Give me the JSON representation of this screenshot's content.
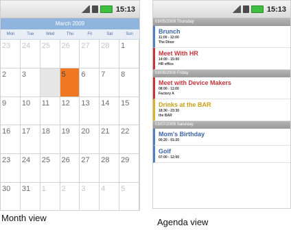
{
  "status": {
    "time": "15:13"
  },
  "month": {
    "title": "March 2009",
    "weekdays": [
      "Mon",
      "Tue",
      "Wed",
      "Thu",
      "Fri",
      "Sat",
      "Sun"
    ],
    "weeks": [
      [
        "23",
        "24",
        "25",
        "26",
        "27",
        "28",
        "1"
      ],
      [
        "2",
        "3",
        "",
        "5",
        "6",
        "7",
        "8"
      ],
      [
        "9",
        "10",
        "11",
        "12",
        "13",
        "14",
        "15"
      ],
      [
        "16",
        "17",
        "18",
        "19",
        "20",
        "21",
        "22"
      ],
      [
        "23",
        "24",
        "25",
        "26",
        "27",
        "28",
        "29"
      ],
      [
        "30",
        "31",
        "1",
        "2",
        "3",
        "4",
        "5"
      ]
    ],
    "caption": "Month view"
  },
  "agenda": {
    "days": [
      {
        "header": "03/05/2009 Thursday",
        "events": [
          {
            "title": "Brunch",
            "time": "11:00 - 12:00",
            "location": "The Diner",
            "color": "#4f7fbf",
            "title_color": "#3b64a8"
          },
          {
            "title": "Meet With HR",
            "time": "14:00 - 15:00",
            "location": "HR office",
            "color": "#c8323a",
            "title_color": "#c8323a"
          }
        ]
      },
      {
        "header": "03/06/2009 Friday",
        "events": [
          {
            "title": "Meet with Device Makers",
            "time": "08:00 - 11:00",
            "location": "Factory A",
            "color": "#c8323a",
            "title_color": "#c8323a"
          },
          {
            "title": "Drinks at the BAR",
            "time": "18:30 - 23:30",
            "location": "the BAR",
            "color": "#d9b225",
            "title_color": "#c79f14"
          }
        ]
      },
      {
        "header": "03/07/2009 Saturday",
        "events": [
          {
            "title": "Mom's Birthday",
            "time": "00:20 - 01:20",
            "location": "",
            "color": "#4f7fbf",
            "title_color": "#3b64a8"
          },
          {
            "title": "Golf",
            "time": "07:00 - 12:00",
            "location": "",
            "color": "#4f7fbf",
            "title_color": "#3b64a8"
          }
        ]
      }
    ],
    "caption": "Agenda view"
  }
}
